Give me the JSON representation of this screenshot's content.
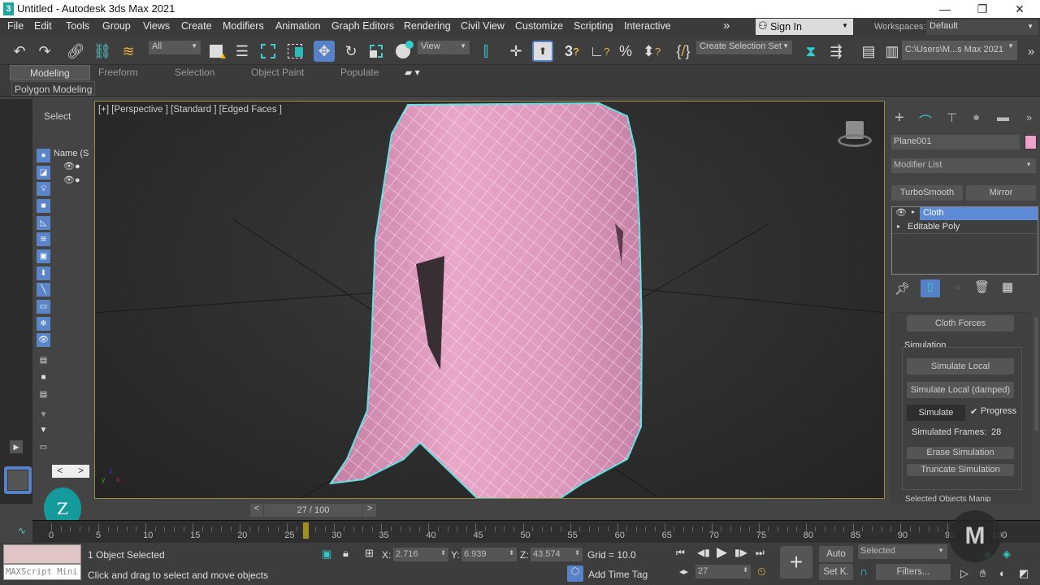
{
  "window": {
    "app_icon": "3",
    "title": "Untitled - Autodesk 3ds Max 2021",
    "minimize": "—",
    "maximize": "❐",
    "close": "✕"
  },
  "menu": {
    "items": [
      "File",
      "Edit",
      "Tools",
      "Group",
      "Views",
      "Create",
      "Modifiers",
      "Animation",
      "Graph Editors",
      "Rendering",
      "Civil View",
      "Customize",
      "Scripting",
      "Interactive"
    ],
    "overflow": "»",
    "sign_in": "Sign In",
    "workspaces_label": "Workspaces:",
    "workspace_value": "Default"
  },
  "toolbar": {
    "selection_filter": "All",
    "reference_coord": "View",
    "selection_set": "Create Selection Set",
    "project_path": "C:\\Users\\M...s Max 2021",
    "overflow": "»"
  },
  "ribbon": {
    "tabs": [
      "Modeling",
      "Freeform",
      "Selection",
      "Object Paint",
      "Populate"
    ],
    "active_tab": "Modeling",
    "panel_label": "Polygon Modeling"
  },
  "scene_explorer": {
    "select_label": "Select",
    "column_header": "Name (So",
    "nav_prev": "<",
    "nav_next": ">"
  },
  "viewport": {
    "label": "[+] [Perspective ] [Standard ] [Edged Faces ]",
    "object_color": "#e8a4c8",
    "selection_outline_color": "#5fe0e0"
  },
  "command_panel": {
    "object_name": "Plane001",
    "object_color": "#f0a0cc",
    "modifier_list": "Modifier List",
    "quick_buttons": [
      "TurboSmooth",
      "Mirror"
    ],
    "stack": [
      {
        "label": "Cloth",
        "selected": true
      },
      {
        "label": "Editable Poly",
        "selected": false
      }
    ],
    "cloth_forces": "Cloth Forces",
    "simulation_group": "Simulation",
    "simulate_local": "Simulate Local",
    "simulate_local_damped": "Simulate Local (damped)",
    "simulate": "Simulate",
    "progress_label": "Progress",
    "progress_checked": true,
    "simulated_frames_label": "Simulated Frames:",
    "simulated_frames": "28",
    "erase_simulation": "Erase Simulation",
    "truncate_simulation": "Truncate Simulation",
    "next_rollout": "Selected Objects Manip"
  },
  "timeline": {
    "frame_display": "27 / 100",
    "prev": "<",
    "next": ">",
    "current_frame": 27,
    "total_frames": 100,
    "tick_labels": [
      "0",
      "5",
      "10",
      "15",
      "20",
      "25",
      "30",
      "35",
      "40",
      "45",
      "50",
      "55",
      "60",
      "65",
      "70",
      "75",
      "80",
      "85",
      "90",
      "95",
      "100"
    ]
  },
  "status": {
    "maxscript_placeholder": "MAXScript Mini",
    "selection_info": "1 Object Selected",
    "prompt": "Click and drag to select and move objects",
    "x_label": "X:",
    "x_value": "2.716",
    "y_label": "Y:",
    "y_value": "6.939",
    "z_label": "Z:",
    "z_value": "43.574",
    "grid": "Grid = 10.0",
    "add_time_tag": "Add Time Tag",
    "auto_key": "Auto",
    "set_key": "Set K.",
    "key_filter_value": "Selected",
    "filters": "Filters...",
    "frame_value": "27"
  },
  "avatar_letter": "Z"
}
